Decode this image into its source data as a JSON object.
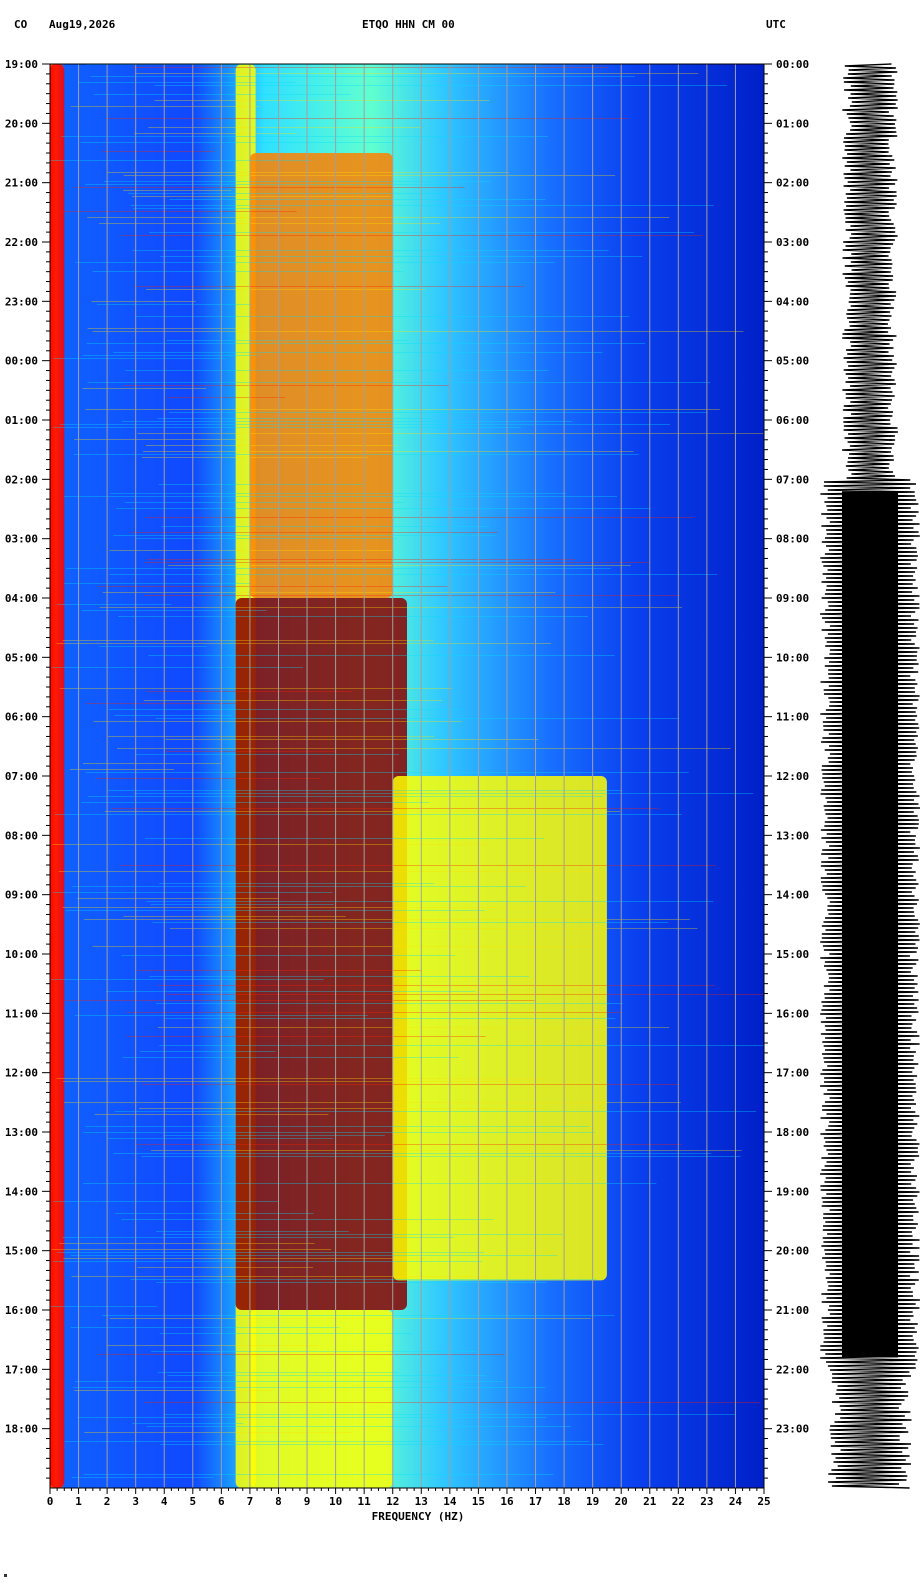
{
  "header": {
    "network": "CO",
    "date": "Aug19,2026",
    "channel": "ETQO HHN CM 00",
    "timezone": "UTC"
  },
  "chart_data": {
    "type": "heatmap",
    "title": "ETQO HHN CM 00",
    "xlabel": "FREQUENCY (HZ)",
    "ylabel": "",
    "xlim": [
      0,
      25
    ],
    "x_ticks": [
      "0",
      "1",
      "2",
      "3",
      "4",
      "5",
      "6",
      "7",
      "8",
      "9",
      "10",
      "11",
      "12",
      "13",
      "14",
      "15",
      "16",
      "17",
      "18",
      "19",
      "20",
      "21",
      "22",
      "23",
      "24",
      "25"
    ],
    "y_left_ticks": [
      "19:00",
      "20:00",
      "21:00",
      "22:00",
      "23:00",
      "00:00",
      "01:00",
      "02:00",
      "03:00",
      "04:00",
      "05:00",
      "06:00",
      "07:00",
      "08:00",
      "09:00",
      "10:00",
      "11:00",
      "12:00",
      "13:00",
      "14:00",
      "15:00",
      "16:00",
      "17:00",
      "18:00"
    ],
    "y_right_ticks": [
      "00:00",
      "01:00",
      "02:00",
      "03:00",
      "04:00",
      "05:00",
      "06:00",
      "07:00",
      "08:00",
      "09:00",
      "10:00",
      "11:00",
      "12:00",
      "13:00",
      "14:00",
      "15:00",
      "16:00",
      "17:00",
      "18:00",
      "19:00",
      "20:00",
      "21:00",
      "22:00",
      "23:00"
    ],
    "grid": true,
    "colormap": [
      "#00008b",
      "#0000ff",
      "#0080ff",
      "#00ffff",
      "#ffff00",
      "#ff8000",
      "#ff0000",
      "#8b0000"
    ],
    "bands": [
      {
        "f0": 0.0,
        "f1": 0.5,
        "hours": [
          0,
          24
        ],
        "intensity": 0.85
      },
      {
        "f0": 6.5,
        "f1": 7.2,
        "hours": [
          0,
          24
        ],
        "intensity": 0.55
      },
      {
        "f0": 7.0,
        "f1": 12.0,
        "hours": [
          1.5,
          9.0
        ],
        "intensity": 0.7
      },
      {
        "f0": 6.5,
        "f1": 12.5,
        "hours": [
          9.0,
          21.0
        ],
        "intensity": 0.95
      },
      {
        "f0": 12.0,
        "f1": 19.5,
        "hours": [
          12.0,
          20.5
        ],
        "intensity": 0.6
      },
      {
        "f0": 7.0,
        "f1": 12.0,
        "hours": [
          21.0,
          24.0
        ],
        "intensity": 0.6
      }
    ]
  }
}
